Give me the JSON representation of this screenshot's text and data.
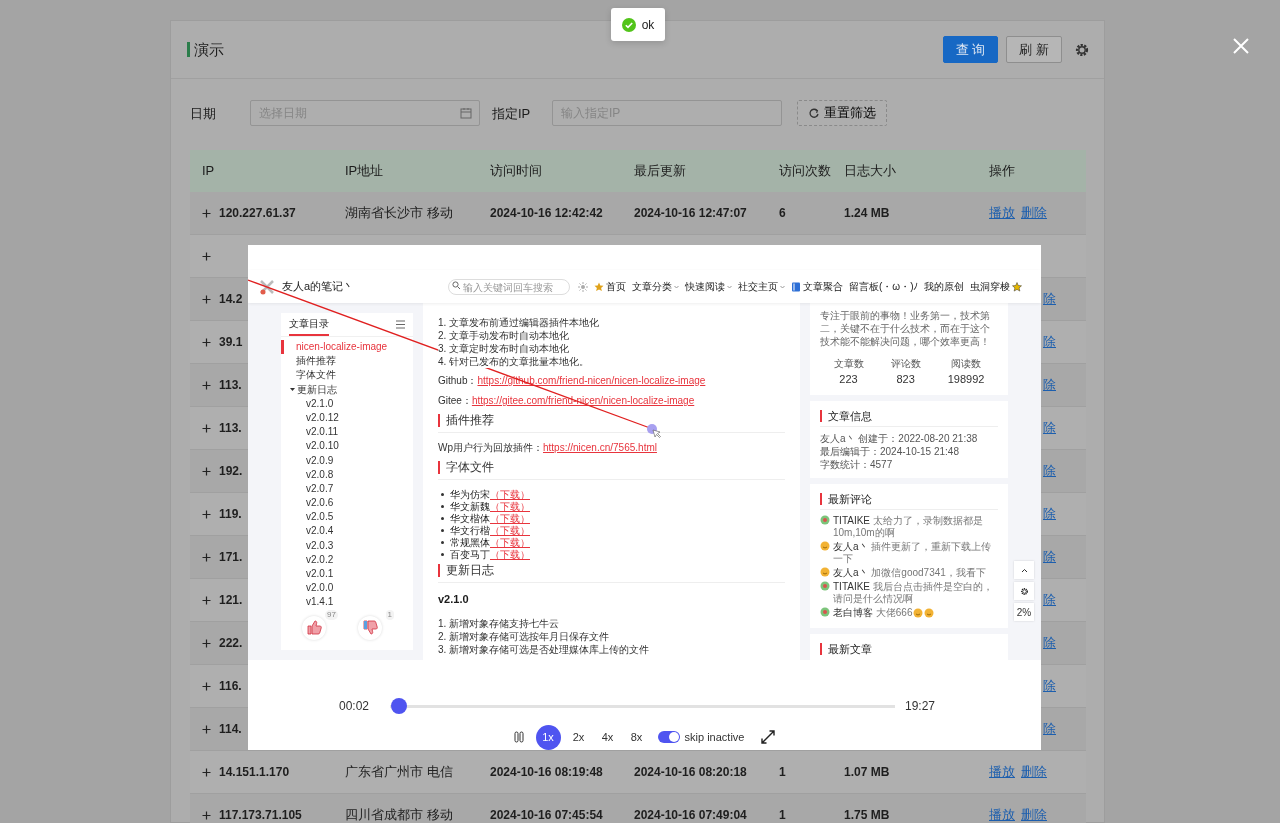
{
  "toast": {
    "text": "ok"
  },
  "panel": {
    "title": "演示",
    "buttons": [
      {
        "label": "查 询",
        "kind": "primary"
      },
      {
        "label": "刷 新",
        "kind": "default"
      }
    ]
  },
  "filters": {
    "date_label": "日期",
    "date_placeholder": "选择日期",
    "ip_label": "指定IP",
    "ip_placeholder": "输入指定IP",
    "reset": "重置筛选"
  },
  "table": {
    "columns": [
      "IP",
      "IP地址",
      "访问时间",
      "最后更新",
      "访问次数",
      "日志大小",
      "操作"
    ],
    "rows": [
      {
        "kind": "full",
        "ip": "120.227.61.37",
        "location": "湖南省长沙市 移动",
        "visit_time": "2024-10-16 12:42:42",
        "last_update": "2024-10-16 12:47:07",
        "visits": "6",
        "size": "1.24 MB",
        "actions": [
          "播放",
          "删除"
        ]
      },
      {
        "kind": "hidden"
      },
      {
        "kind": "covered",
        "ip": "14.2",
        "actions": [
          "除"
        ]
      },
      {
        "kind": "covered",
        "ip": "39.1",
        "actions": [
          "除"
        ]
      },
      {
        "kind": "covered",
        "ip": "113.",
        "actions": [
          "除"
        ]
      },
      {
        "kind": "covered",
        "ip": "113.",
        "actions": [
          "除"
        ]
      },
      {
        "kind": "covered",
        "ip": "192.",
        "actions": [
          "除"
        ]
      },
      {
        "kind": "covered",
        "ip": "119.",
        "actions": [
          "除"
        ]
      },
      {
        "kind": "covered",
        "ip": "171.",
        "actions": [
          "除"
        ]
      },
      {
        "kind": "covered",
        "ip": "121.",
        "actions": [
          "除"
        ]
      },
      {
        "kind": "covered",
        "ip": "222.",
        "actions": [
          "除"
        ]
      },
      {
        "kind": "covered",
        "ip": "116.",
        "actions": [
          "除"
        ]
      },
      {
        "kind": "covered",
        "ip": "114.",
        "actions": [
          "除"
        ]
      },
      {
        "kind": "full",
        "ip": "14.151.1.170",
        "location": "广东省广州市 电信",
        "visit_time": "2024-10-16 08:19:48",
        "last_update": "2024-10-16 08:20:18",
        "visits": "1",
        "size": "1.07 MB",
        "actions": [
          "播放",
          "删除"
        ]
      },
      {
        "kind": "full",
        "ip": "117.173.71.105",
        "location": "四川省成都市 移动",
        "visit_time": "2024-10-16 07:45:54",
        "last_update": "2024-10-16 07:49:04",
        "visits": "1",
        "size": "1.75 MB",
        "actions": [
          "播放",
          "删除"
        ]
      }
    ]
  },
  "replay": {
    "site": {
      "name": "友人a的笔记丶",
      "search_placeholder": "输入关键词回车搜索",
      "nav": [
        {
          "label": "首页",
          "kind": "star"
        },
        {
          "label": "文章分类",
          "kind": "plain",
          "dropdown": true
        },
        {
          "label": "快速阅读",
          "kind": "plain",
          "dropdown": true
        },
        {
          "label": "社交主页",
          "kind": "plain",
          "dropdown": true
        },
        {
          "label": "文章聚合",
          "kind": "book"
        },
        {
          "label": "留言板(・ω・)ﾉ",
          "kind": "plain"
        },
        {
          "label": "我的原创",
          "kind": "plain"
        },
        {
          "label": "虫洞穿梭",
          "kind": "plain",
          "trail_icon": true
        }
      ]
    },
    "toc": {
      "title": "文章目录",
      "items": [
        {
          "label": "nicen-localize-image",
          "selected": true
        },
        {
          "label": "插件推荐",
          "selected": false
        },
        {
          "label": "字体文件",
          "selected": false
        },
        {
          "label": "更新日志",
          "selected": false,
          "expanded": true,
          "children": [
            {
              "label": "v2.1.0",
              "selected": false
            },
            {
              "label": "v2.0.12",
              "selected": false
            },
            {
              "label": "v2.0.11",
              "selected": false
            },
            {
              "label": "v2.0.10",
              "selected": false
            },
            {
              "label": "v2.0.9",
              "selected": false
            },
            {
              "label": "v2.0.8",
              "selected": false
            },
            {
              "label": "v2.0.7",
              "selected": false
            },
            {
              "label": "v2.0.6",
              "selected": false
            },
            {
              "label": "v2.0.5",
              "selected": false
            },
            {
              "label": "v2.0.4",
              "selected": false
            },
            {
              "label": "v2.0.3",
              "selected": false
            },
            {
              "label": "v2.0.2",
              "selected": false
            },
            {
              "label": "v2.0.1",
              "selected": false
            },
            {
              "label": "v2.0.0",
              "selected": false
            },
            {
              "label": "v1.4.1",
              "selected": false
            }
          ]
        }
      ],
      "votes": {
        "up": "97",
        "down": "1"
      }
    },
    "article": [
      {
        "kind": "list",
        "items": [
          "1. 文章发布前通过编辑器插件本地化",
          "2. 文章手动发布时自动本地化",
          "3. 文章定时发布时自动本地化",
          "4. 针对已发布的文章批量本地化。"
        ]
      },
      {
        "kind": "link_line",
        "label": "Github：",
        "link": "https://github.com/friend-nicen/nicen-localize-image"
      },
      {
        "kind": "link_line",
        "label": "Gitee：",
        "link": "https://gitee.com/friend-nicen/nicen-localize-image"
      },
      {
        "kind": "heading",
        "text": "插件推荐"
      },
      {
        "kind": "link_line",
        "label": "Wp用户行为回放插件：",
        "link": "https://nicen.cn/7565.html"
      },
      {
        "kind": "heading",
        "text": "字体文件"
      },
      {
        "kind": "bullets",
        "items": [
          {
            "text": "华为仿宋",
            "link": "（下载）"
          },
          {
            "text": "华文新魏",
            "link": "（下载）"
          },
          {
            "text": "华文楷体",
            "link": "（下载）"
          },
          {
            "text": "华文行楷",
            "link": "（下载）"
          },
          {
            "text": "常规黑体",
            "link": "（下载）"
          },
          {
            "text": "百变马丁",
            "link": "（下载）"
          }
        ]
      },
      {
        "kind": "heading",
        "text": "更新日志"
      },
      {
        "kind": "subheading",
        "text": "v2.1.0"
      },
      {
        "kind": "list",
        "items": [
          "1. 新增对象存储支持七牛云",
          "2. 新增对象存储可选按年月日保存文件",
          "3. 新增对象存储可选是否处理媒体库上传的文件"
        ]
      }
    ],
    "about": {
      "text": "专注于眼前的事物！业务第一，技术第二，关键不在于什么技术，而在于这个技术能不能解决问题，哪个效率更高！",
      "stats": [
        {
          "label": "文章数",
          "value": "223"
        },
        {
          "label": "评论数",
          "value": "823"
        },
        {
          "label": "阅读数",
          "value": "198992"
        }
      ]
    },
    "info": {
      "title": "文章信息",
      "lines": [
        "友人a丶 创建于：2022-08-20 21:38",
        "最后编辑于：2024-10-15 21:48",
        "字数统计：4577"
      ]
    },
    "comments": {
      "title": "最新评论",
      "items": [
        {
          "author": "TITAIKE",
          "text": "太给力了，录制数据都是10m,10m的啊",
          "kind": "flower"
        },
        {
          "author": "友人a丶",
          "text": "插件更新了，重新下载上传一下",
          "kind": "smiley"
        },
        {
          "author": "友人a丶",
          "text": "加微信good7341，我看下",
          "kind": "smiley"
        },
        {
          "author": "TITAIKE",
          "text": "我后台点击插件是空白的，请问是什么情况啊",
          "kind": "flower"
        },
        {
          "author": "老白博客",
          "text": "大佬666",
          "kind": "flower",
          "reactions": true
        }
      ]
    },
    "latest": {
      "title": "最新文章"
    },
    "float_buttons": [
      {
        "kind": "up"
      },
      {
        "kind": "gear"
      },
      {
        "kind": "text",
        "label": "2%"
      }
    ],
    "player": {
      "current": "00:02",
      "total": "19:27",
      "level": 0.002,
      "playing": true,
      "speeds": [
        {
          "label": "1x",
          "selected": true
        },
        {
          "label": "2x",
          "selected": false
        },
        {
          "label": "4x",
          "selected": false
        },
        {
          "label": "8x",
          "selected": false
        }
      ],
      "skip_inactive": {
        "label": "skip inactive",
        "on": true
      }
    }
  }
}
